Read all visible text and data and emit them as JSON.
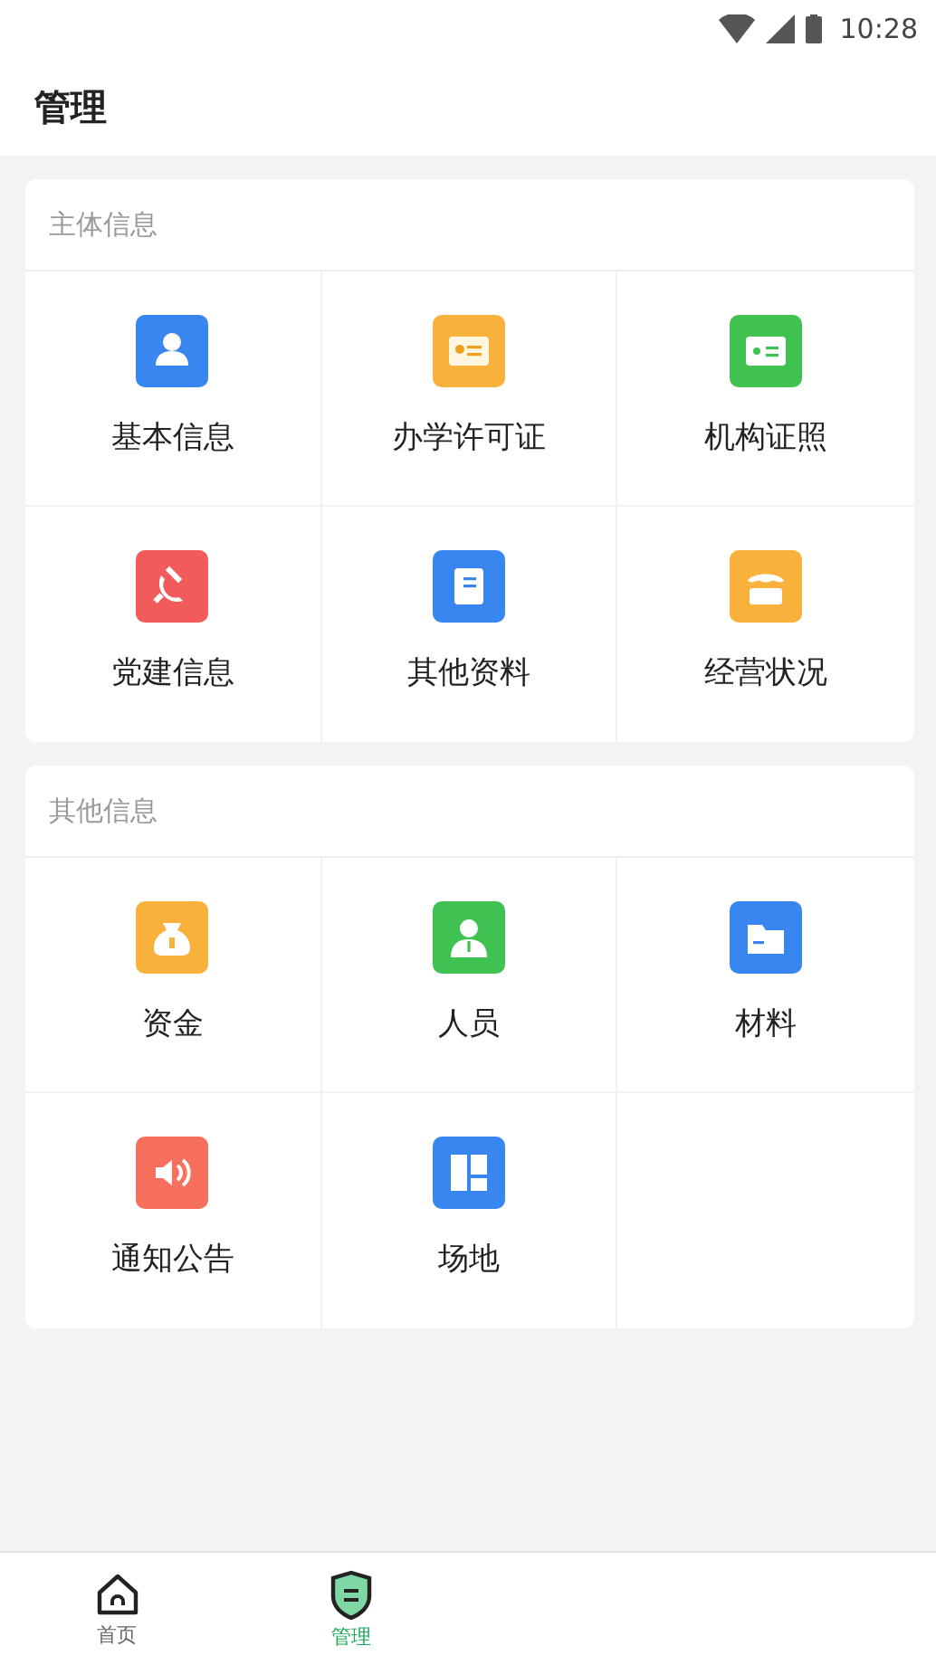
{
  "status_bar": {
    "time": "10:28"
  },
  "header": {
    "title": "管理"
  },
  "sections": [
    {
      "title": "主体信息",
      "items": [
        {
          "label": "基本信息",
          "kind": "person",
          "color": "#3a86f0"
        },
        {
          "label": "办学许可证",
          "kind": "license",
          "color": "#f8b23c"
        },
        {
          "label": "机构证照",
          "kind": "card",
          "color": "#3fc252"
        },
        {
          "label": "党建信息",
          "kind": "party",
          "color": "#f25b5b"
        },
        {
          "label": "其他资料",
          "kind": "doc",
          "color": "#3a86f0"
        },
        {
          "label": "经营状况",
          "kind": "shop",
          "color": "#f8b23c"
        }
      ]
    },
    {
      "title": "其他信息",
      "items": [
        {
          "label": "资金",
          "kind": "money",
          "color": "#f8b23c"
        },
        {
          "label": "人员",
          "kind": "staff",
          "color": "#3fc252"
        },
        {
          "label": "材料",
          "kind": "folder",
          "color": "#3a86f0"
        },
        {
          "label": "通知公告",
          "kind": "speaker",
          "color": "#f7705e"
        },
        {
          "label": "场地",
          "kind": "layout",
          "color": "#3a86f0"
        }
      ]
    }
  ],
  "bottom_nav": [
    {
      "label": "首页",
      "kind": "home",
      "selected": false
    },
    {
      "label": "管理",
      "kind": "shield",
      "selected": true
    }
  ]
}
